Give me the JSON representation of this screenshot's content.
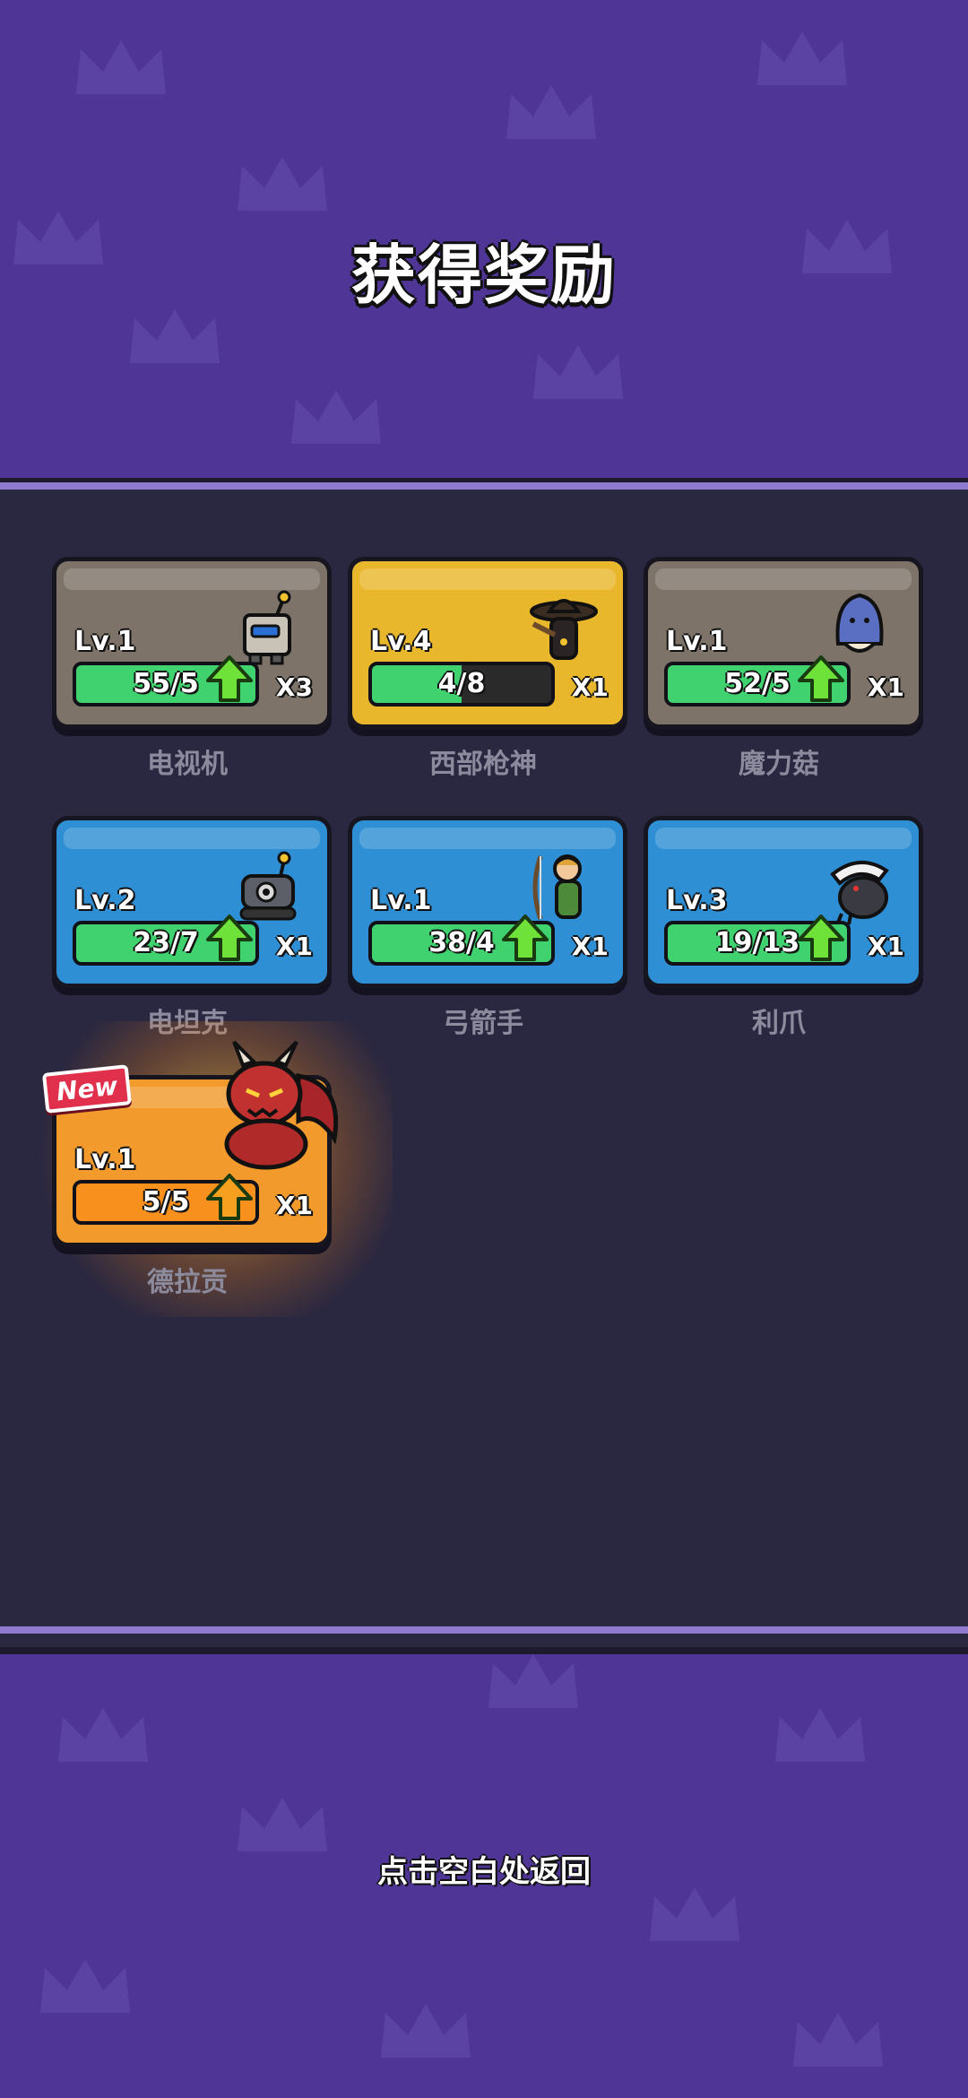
{
  "title": "获得奖励",
  "back_hint": "点击空白处返回",
  "new_label": "New",
  "colors": {
    "background": "#4e3596",
    "panel": "#2a2740",
    "bar_green": "#3fd26e",
    "bar_orange": "#f7901d",
    "card_gray": "#7d7368",
    "card_gold": "#e9b72b",
    "card_blue": "#2f8fd4",
    "card_orange": "#f29a2c"
  },
  "rewards": [
    {
      "name": "电视机",
      "level": "Lv.1",
      "progress": "55/5",
      "count": "X3",
      "rarity": "gray",
      "fill": 1.0,
      "icon": "tv-robot-icon",
      "upgrade": true
    },
    {
      "name": "西部枪神",
      "level": "Lv.4",
      "progress": "4/8",
      "count": "X1",
      "rarity": "gold",
      "fill": 0.5,
      "icon": "gunslinger-icon",
      "upgrade": false
    },
    {
      "name": "魔力菇",
      "level": "Lv.1",
      "progress": "52/5",
      "count": "X1",
      "rarity": "gray",
      "fill": 1.0,
      "icon": "mushroom-icon",
      "upgrade": true
    },
    {
      "name": "电坦克",
      "level": "Lv.2",
      "progress": "23/7",
      "count": "X1",
      "rarity": "blue",
      "fill": 1.0,
      "icon": "tank-robot-icon",
      "upgrade": true
    },
    {
      "name": "弓箭手",
      "level": "Lv.1",
      "progress": "38/4",
      "count": "X1",
      "rarity": "blue",
      "fill": 1.0,
      "icon": "archer-icon",
      "upgrade": true
    },
    {
      "name": "利爪",
      "level": "Lv.3",
      "progress": "19/13",
      "count": "X1",
      "rarity": "blue",
      "fill": 1.0,
      "icon": "claw-beast-icon",
      "upgrade": true
    },
    {
      "name": "德拉贡",
      "level": "Lv.1",
      "progress": "5/5",
      "count": "X1",
      "rarity": "orange",
      "fill": 1.0,
      "icon": "red-dragon-icon",
      "upgrade": true,
      "is_new": true
    }
  ]
}
